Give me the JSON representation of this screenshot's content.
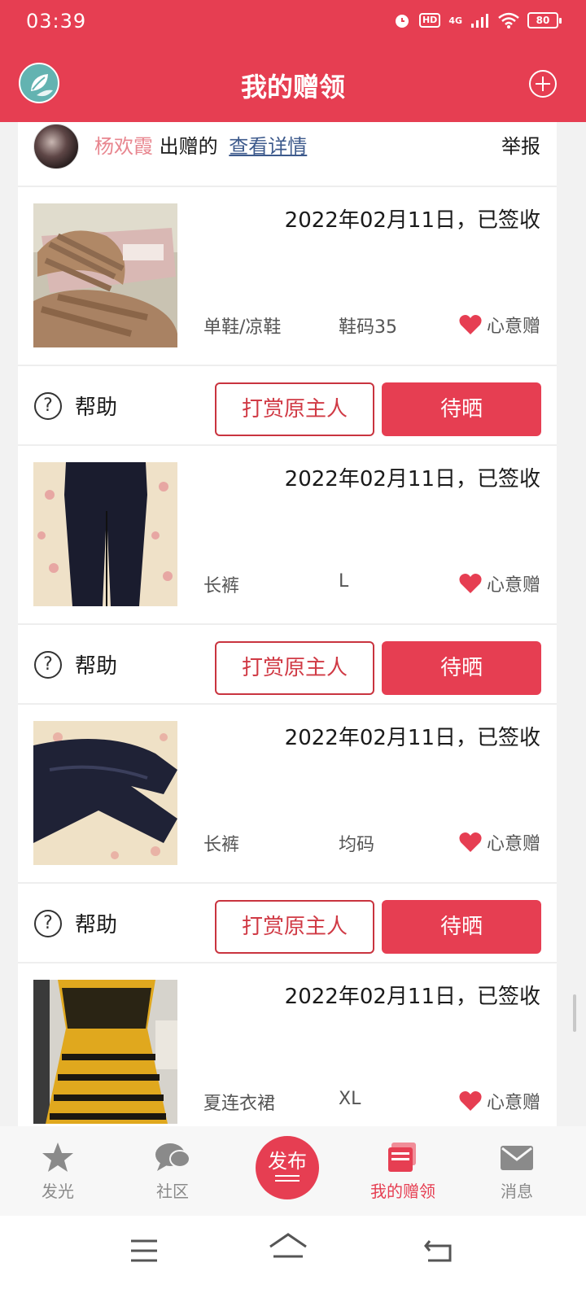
{
  "status_bar": {
    "time": "03:39",
    "network": "4G",
    "hd_label": "HD",
    "battery": "80"
  },
  "app_bar": {
    "title": "我的赠领",
    "add_icon": "plus-circle-icon"
  },
  "giver_row": {
    "giver_name": "杨欢霞",
    "action_text": "出赠的",
    "details_link": "查看详情",
    "report": "举报"
  },
  "items": [
    {
      "date_status": "2022年02月11日，已签收",
      "category": "单鞋/凉鞋",
      "size": "鞋码35",
      "gift_type": "心意赠",
      "photo": "sandals-photo"
    },
    {
      "date_status": "2022年02月11日，已签收",
      "category": "长裤",
      "size": "L",
      "gift_type": "心意赠",
      "photo": "dark-trousers-photo"
    },
    {
      "date_status": "2022年02月11日，已签收",
      "category": "长裤",
      "size": "均码",
      "gift_type": "心意赠",
      "photo": "velvet-trousers-photo"
    },
    {
      "date_status": "2022年02月11日，已签收",
      "category": "夏连衣裙",
      "size": "XL",
      "gift_type": "心意赠",
      "photo": "yellow-dress-photo"
    }
  ],
  "actions": {
    "help": "帮助",
    "tip_button": "打赏原主人",
    "show_button": "待晒"
  },
  "bottom_nav": {
    "items": [
      {
        "label": "发光",
        "icon": "star-icon"
      },
      {
        "label": "社区",
        "icon": "chat-bubble-icon"
      },
      {
        "label": "发布",
        "icon": "publish-icon"
      },
      {
        "label": "我的赠领",
        "icon": "gift-box-icon"
      },
      {
        "label": "消息",
        "icon": "mail-icon"
      }
    ],
    "active_index": 3
  },
  "colors": {
    "brand": "#e63e52",
    "giver_name": "#e8868f",
    "link": "#3d5a8c"
  }
}
